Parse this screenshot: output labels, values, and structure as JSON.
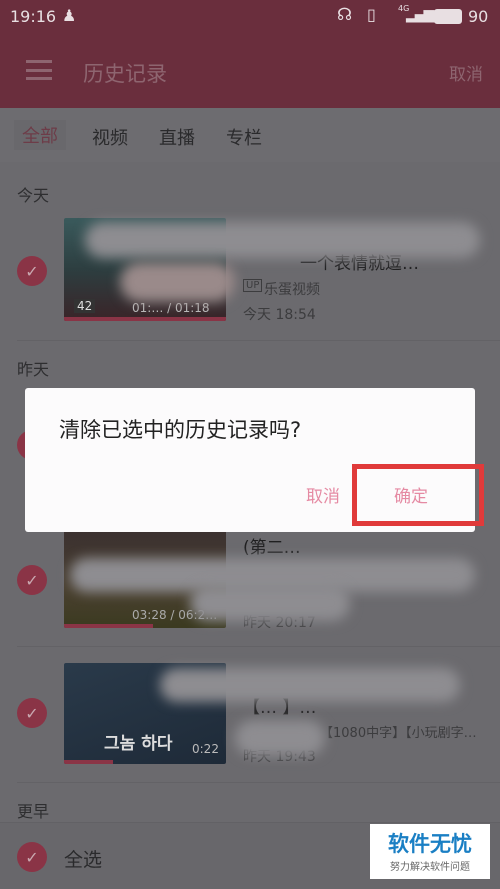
{
  "status_bar": {
    "time": "19:16",
    "battery": "90",
    "network": "4G",
    "icons": [
      "qq-icon",
      "headphone-icon",
      "vibrate-icon",
      "signal-icon",
      "battery-icon"
    ]
  },
  "header": {
    "title": "历史记录",
    "cancel": "取消",
    "menu_icon": "hamburger-icon"
  },
  "tabs": [
    {
      "label": "全部",
      "active": true
    },
    {
      "label": "视频"
    },
    {
      "label": "直播"
    },
    {
      "label": "专栏"
    }
  ],
  "sections": {
    "today": "今天",
    "yesterday": "昨天",
    "earlier": "更早"
  },
  "items": [
    {
      "title": "一个表情就逗…",
      "uploader_badge": "UP",
      "uploader": "乐蛋视频",
      "time": "今天 18:54",
      "thumb_badge": "42",
      "progress_text": "01:… / 01:18",
      "checked": true
    },
    {
      "title": "(第二…",
      "time": "昨天 20:17",
      "progress_text": "03:28 / 06:2…",
      "checked": true
    },
    {
      "title": "【… 】…",
      "subtitle": "【1080中字】【小玩剧字…",
      "time": "昨天 19:43",
      "progress_text": "0:22",
      "thumb_text": "그놈 하다",
      "checked": true
    }
  ],
  "dialog": {
    "message": "清除已选中的历史记录吗?",
    "cancel": "取消",
    "confirm": "确定"
  },
  "bottom": {
    "select_all": "全选",
    "checked": true
  },
  "watermark": {
    "title": "软件无忧",
    "subtitle": "努力解决软件问题"
  },
  "colors": {
    "accent": "#e05c7b",
    "highlight": "#e03a3a",
    "dialog_button": "#e58aa3",
    "watermark": "#1a7fc4"
  }
}
